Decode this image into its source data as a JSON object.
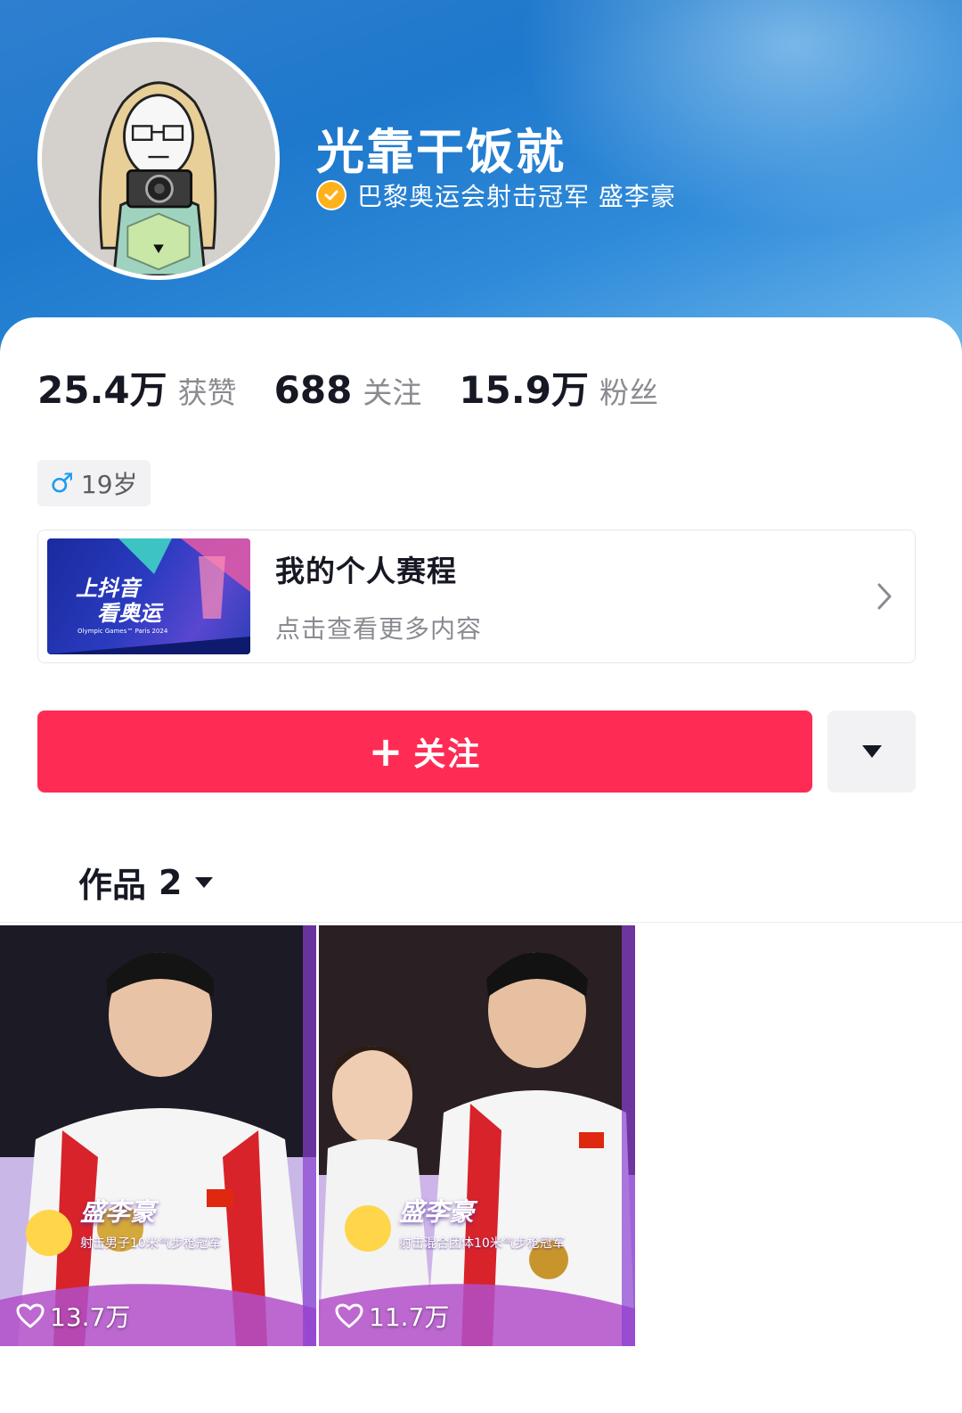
{
  "profile": {
    "nickname": "光靠干饭就",
    "verification": "巴黎奥运会射击冠军 盛李豪"
  },
  "stats": [
    {
      "value": "25.4万",
      "label": "获赞"
    },
    {
      "value": "688",
      "label": "关注"
    },
    {
      "value": "15.9万",
      "label": "粉丝"
    }
  ],
  "tag": {
    "gender_symbol": "♂",
    "age": "19岁"
  },
  "schedule": {
    "thumb_line1": "上抖音",
    "thumb_line2": "看奥运",
    "thumb_line3": "Olympic Games™ Paris 2024",
    "title": "我的个人赛程",
    "subtitle": "点击查看更多内容"
  },
  "actions": {
    "follow_plus": "+",
    "follow_label": "关注"
  },
  "tabs": {
    "label": "作品",
    "count": "2"
  },
  "videos": [
    {
      "name_overlay": "盛李豪",
      "title_overlay": "射击男子10米气步枪冠军",
      "likes": "13.7万"
    },
    {
      "name_overlay": "盛李豪",
      "title_overlay": "射击混合团体10米气步枪冠军",
      "likes": "11.7万"
    }
  ],
  "colors": {
    "follow_button": "#fe2c55",
    "verify_badge": "#ffb11b",
    "header": "#1e78cc"
  }
}
